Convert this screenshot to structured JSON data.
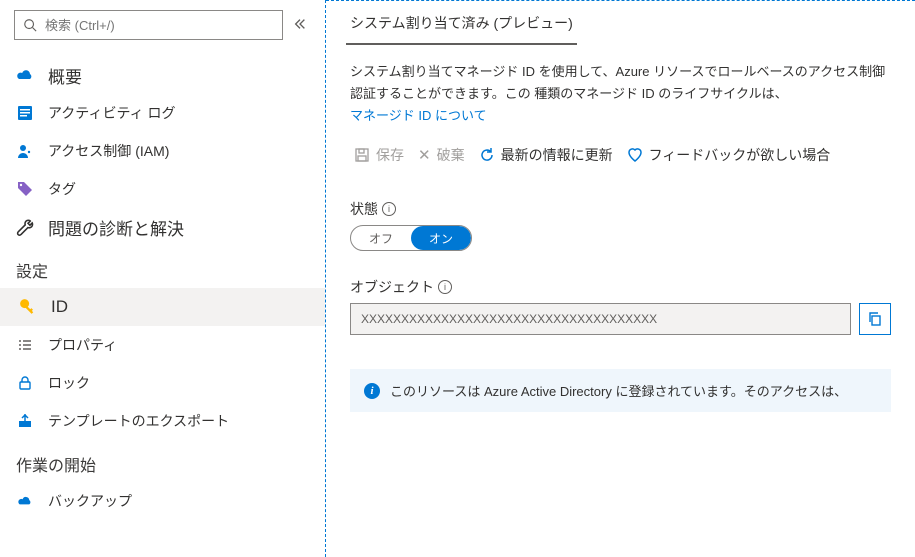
{
  "search": {
    "placeholder": "検索 (Ctrl+/)"
  },
  "nav": {
    "overview": "概要",
    "activity": "アクティビティ ログ",
    "iam": "アクセス制御 (IAM)",
    "tags": "タグ",
    "diagnose": "問題の診断と解決"
  },
  "section_settings": "設定",
  "settings": {
    "id": "ID",
    "properties": "プロパティ",
    "locks": "ロック",
    "export": "テンプレートのエクスポート"
  },
  "section_getstarted": "作業の開始",
  "getstarted": {
    "backup": "バックアップ"
  },
  "tab": {
    "system": "システム割り当て済み (プレビュー)"
  },
  "desc": {
    "line1": "システム割り当てマネージド ID を使用して、Azure リソースでロールベースのアクセス制御",
    "line2": "認証することができます。この 種類のマネージド  ID のライフサイクルは、",
    "link": "マネージド ID について"
  },
  "toolbar": {
    "save": "保存",
    "discard": "破棄",
    "refresh": "最新の情報に更新",
    "feedback": "フィードバックが欲しい場合"
  },
  "status": {
    "label": "状態",
    "off": "オフ",
    "on": "オン"
  },
  "object": {
    "label": "オブジェクト",
    "value": "XXXXXXXXXXXXXXXXXXXXXXXXXXXXXXXXXXXXX"
  },
  "info": {
    "text": "このリソースは Azure Active Directory に登録されています。そのアクセスは、"
  }
}
